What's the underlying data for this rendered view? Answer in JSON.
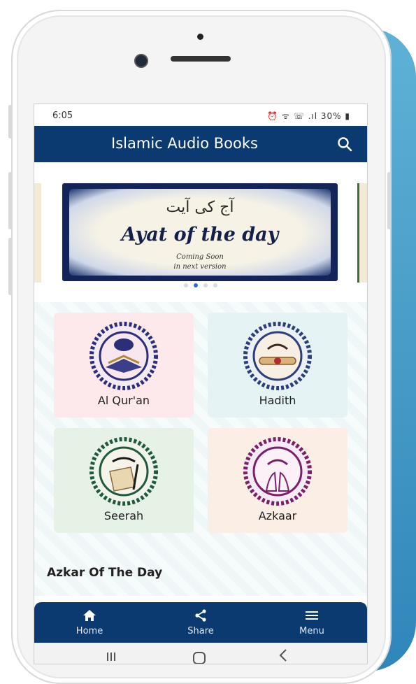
{
  "status_bar": {
    "time": "6:05",
    "icons": "⏰ ᯤ ☏ .ıl 30% ▮"
  },
  "app_bar": {
    "title": "Islamic Audio Books",
    "search_icon": "search-icon"
  },
  "banner": {
    "urdu_text": "آج کی آیت",
    "title": "Ayat of the day",
    "line1": "Coming Soon",
    "line2": "in next version",
    "slide_count": 4,
    "active_slide": 2
  },
  "categories": [
    {
      "label": "Al Qur'an",
      "bg": "#fde9ec",
      "accent": "#2b2f7a"
    },
    {
      "label": "Hadith",
      "bg": "#e6f3f5",
      "accent": "#2b3f7a"
    },
    {
      "label": "Seerah",
      "bg": "#e7f2e7",
      "accent": "#1f5a3a"
    },
    {
      "label": "Azkaar",
      "bg": "#fbeee4",
      "accent": "#7a1f6a"
    }
  ],
  "section_title": "Azkar Of The Day",
  "bottom_nav": [
    {
      "label": "Home",
      "icon": "home-icon"
    },
    {
      "label": "Share",
      "icon": "share-icon"
    },
    {
      "label": "Menu",
      "icon": "menu-icon"
    }
  ],
  "colors": {
    "primary": "#0a3a70",
    "dot_active": "#2f6bd2"
  }
}
